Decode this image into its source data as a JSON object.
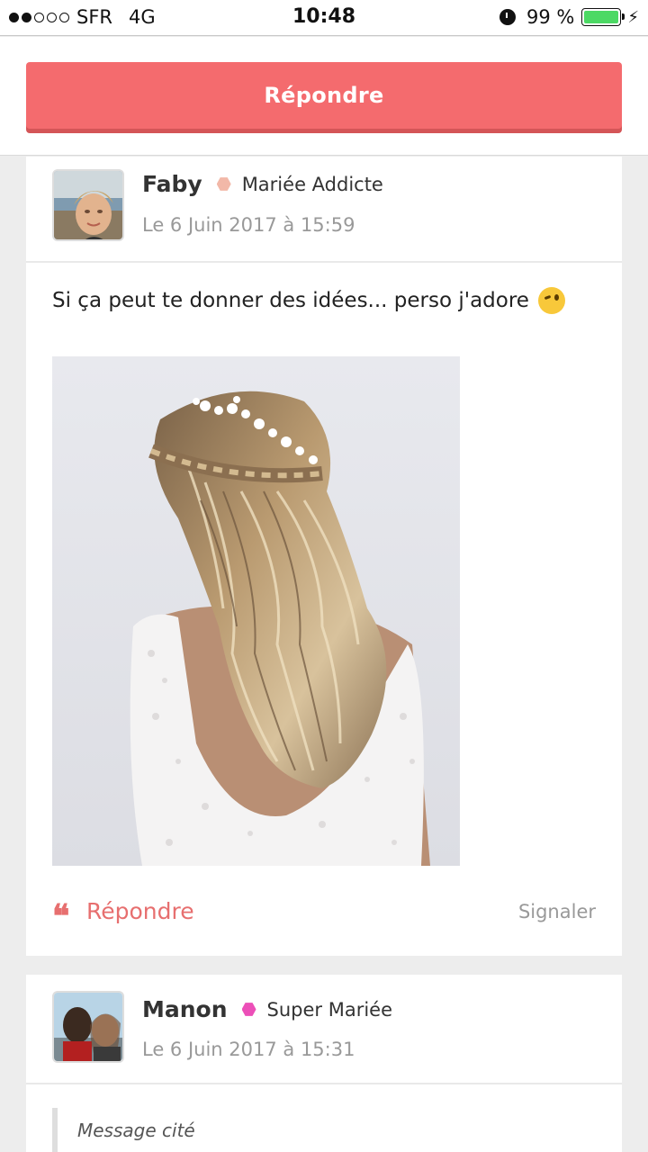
{
  "status_bar": {
    "carrier": "SFR",
    "network": "4G",
    "time": "10:48",
    "battery": "99 %",
    "battery_level": 0.99,
    "signal_bars": 2,
    "icons": [
      "signal-dots-icon",
      "alarm-clock-icon",
      "battery-icon",
      "charging-bolt-icon"
    ]
  },
  "header": {
    "reply_button_label": "Répondre"
  },
  "posts": [
    {
      "author": "Faby",
      "rank": "Mariée Addicte",
      "rank_color": "#f2b8a8",
      "date": "Le 6 Juin 2017 à 15:59",
      "text": "Si ça peut te donner des idées... perso j'adore",
      "emoji": "winking-face-icon",
      "reply_label": "Répondre",
      "report_label": "Signaler"
    },
    {
      "author": "Manon",
      "rank": "Super Mariée",
      "rank_color": "#ec4fb8",
      "date": "Le 6 Juin 2017 à 15:31",
      "quoted_label": "Message cité"
    }
  ],
  "colors": {
    "accent": "#f46b6e",
    "link": "#e76f6f"
  }
}
